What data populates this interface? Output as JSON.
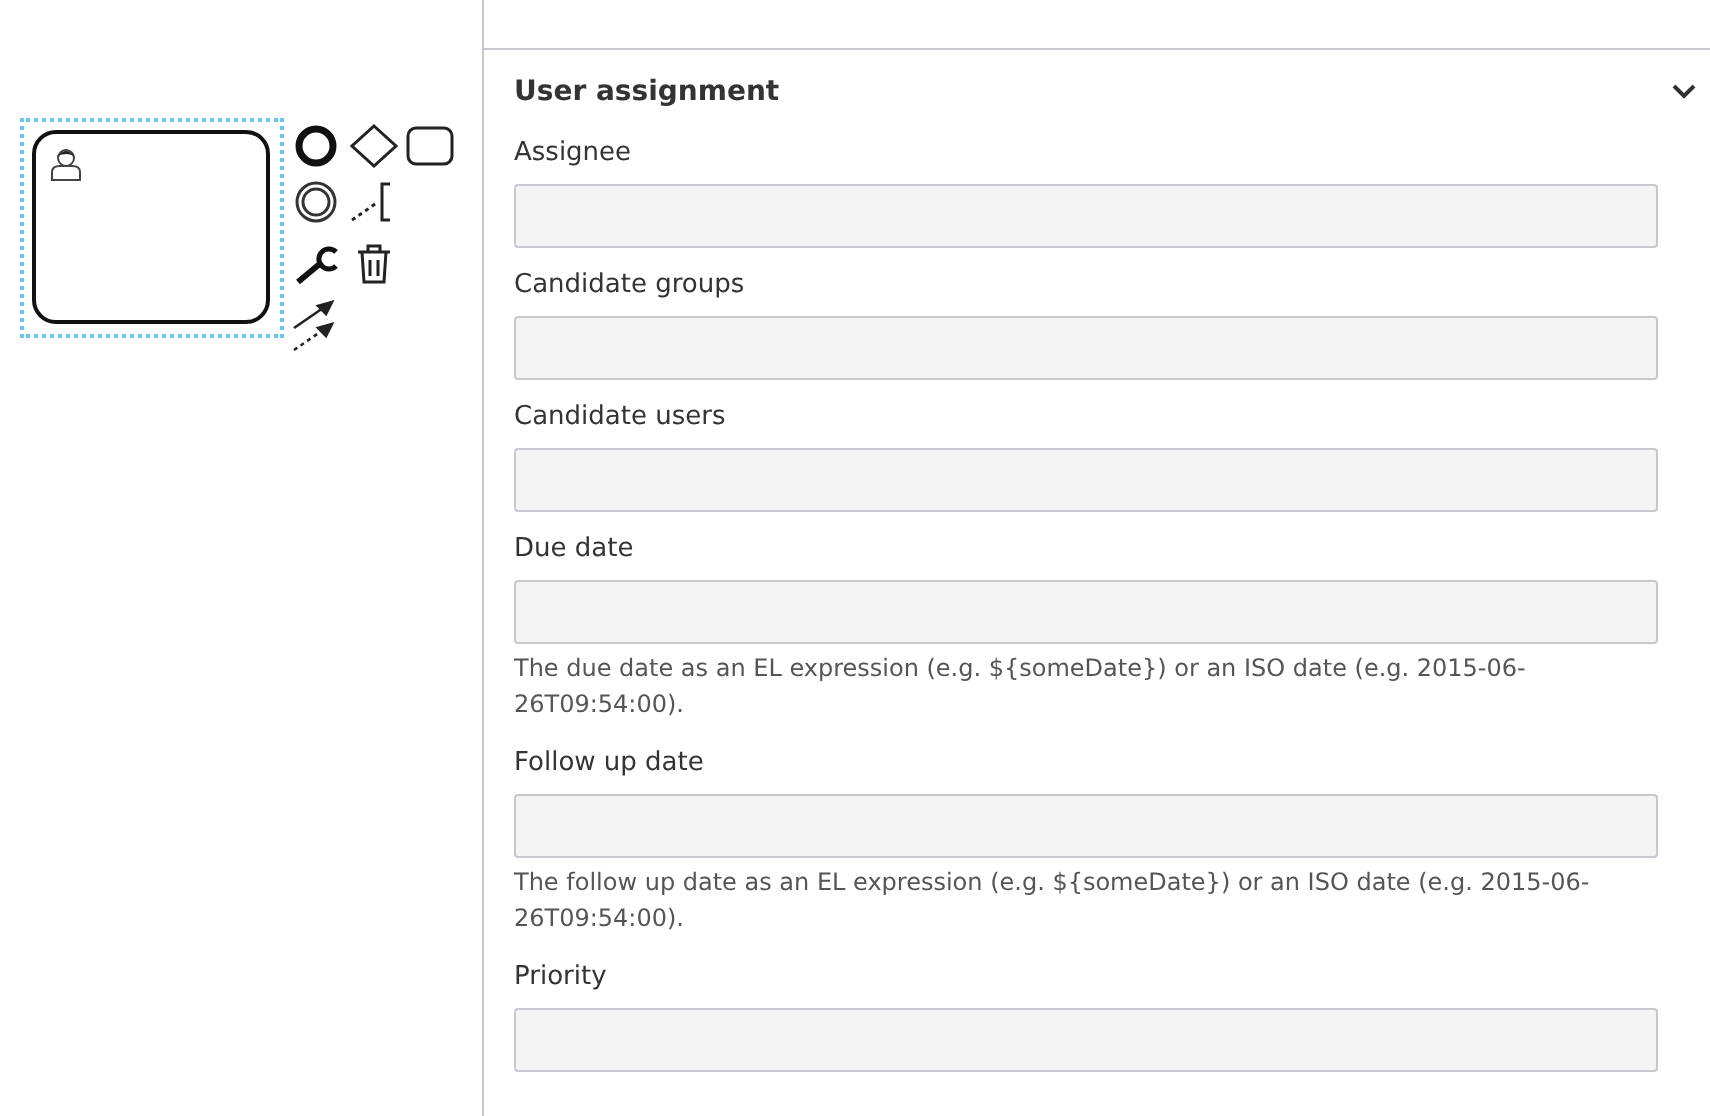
{
  "section": {
    "title": "User assignment",
    "expanded": true
  },
  "fields": [
    {
      "label": "Assignee"
    },
    {
      "label": "Candidate groups"
    },
    {
      "label": "Candidate users"
    },
    {
      "label": "Due date",
      "description": "The due date as an EL expression (e.g. ${someDate}) or an ISO date (e.g. 2015-06-26T09:54:00)."
    },
    {
      "label": "Follow up date",
      "description": "The follow up date as an EL expression (e.g. ${someDate}) or an ISO date (e.g. 2015-06-26T09:54:00)."
    },
    {
      "label": "Priority"
    }
  ]
}
